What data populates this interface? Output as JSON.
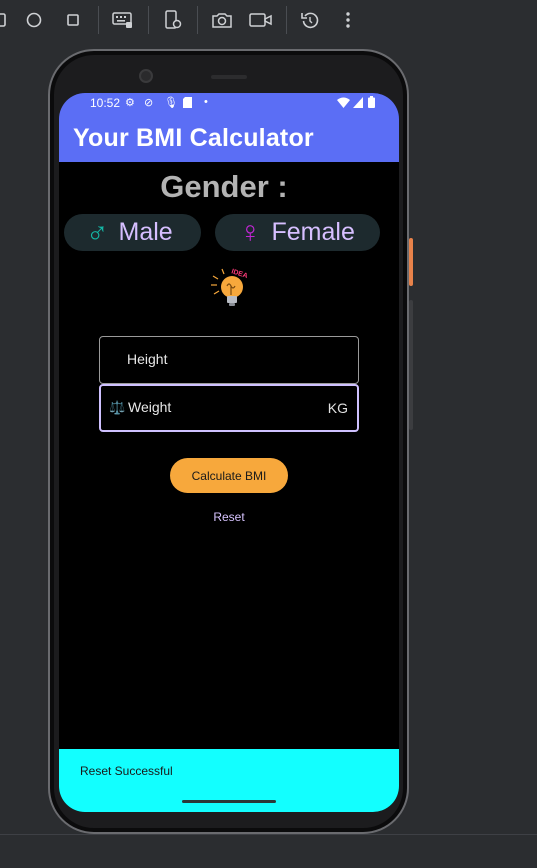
{
  "toolbar": {
    "icons": [
      "power-icon",
      "home-circle-icon",
      "overview-square-icon",
      "keyboard-icon",
      "device-settings-icon",
      "camera-icon",
      "video-record-icon",
      "rotate-icon",
      "more-icon"
    ]
  },
  "status_bar": {
    "time": "10:52"
  },
  "app": {
    "title": "Your BMI Calculator",
    "gender_heading": "Gender :",
    "male": {
      "symbol": "♂",
      "label": "Male",
      "color": "#14b8a6"
    },
    "female": {
      "symbol": "♀",
      "label": "Female",
      "color": "#c026d3"
    },
    "idea_badge": "IDEA",
    "height_field": {
      "placeholder": "Height"
    },
    "weight_field": {
      "placeholder": "Weight",
      "icon": "⚖️",
      "suffix": "KG"
    },
    "calculate_label": "Calculate BMI",
    "reset_label": "Reset",
    "accent_color": "#5b6ef5",
    "button_color": "#f7a83c"
  },
  "snackbar": {
    "message": "Reset Successful",
    "background": "#12ffff"
  }
}
